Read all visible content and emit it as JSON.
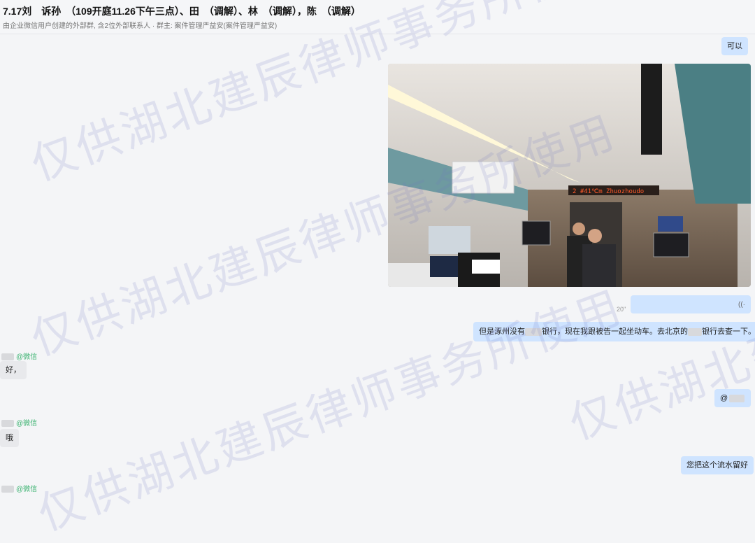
{
  "header": {
    "title": "7.17刘　诉孙　（109开庭11.26下午三点）、田　（调解）、林　（调解），陈　（调解）",
    "subtitle": "由企业微信用户创建的外部群, 含2位外部联系人 · 群主: 案件管理严益安(案件管理严益安)"
  },
  "messages": [
    {
      "side": "right",
      "type": "text",
      "text": "可以"
    },
    {
      "side": "right",
      "type": "image",
      "image_caption": "高铁车厢内照片"
    },
    {
      "side": "right",
      "type": "voice",
      "duration": "20\""
    },
    {
      "side": "right",
      "type": "text",
      "text_a": "但是涿州没有",
      "text_b": "银行，现在我跟被告一起坐动车。去北京的",
      "text_c": "银行去查一下。"
    },
    {
      "side": "left",
      "type": "text",
      "sender_suffix": "@微信",
      "text": "好，"
    },
    {
      "side": "right",
      "type": "text",
      "text": "@"
    },
    {
      "side": "left",
      "type": "text",
      "sender_suffix": "@微信",
      "text": "哦"
    },
    {
      "side": "right",
      "type": "text",
      "text": "您把这个流水留好"
    },
    {
      "side": "left",
      "type": "text",
      "sender_suffix": "@微信"
    }
  ],
  "watermark": {
    "text": "仅供湖北建辰律师事务所使用",
    "color": "#6e78be"
  },
  "icons": {
    "voice": "voice-wave-icon"
  }
}
